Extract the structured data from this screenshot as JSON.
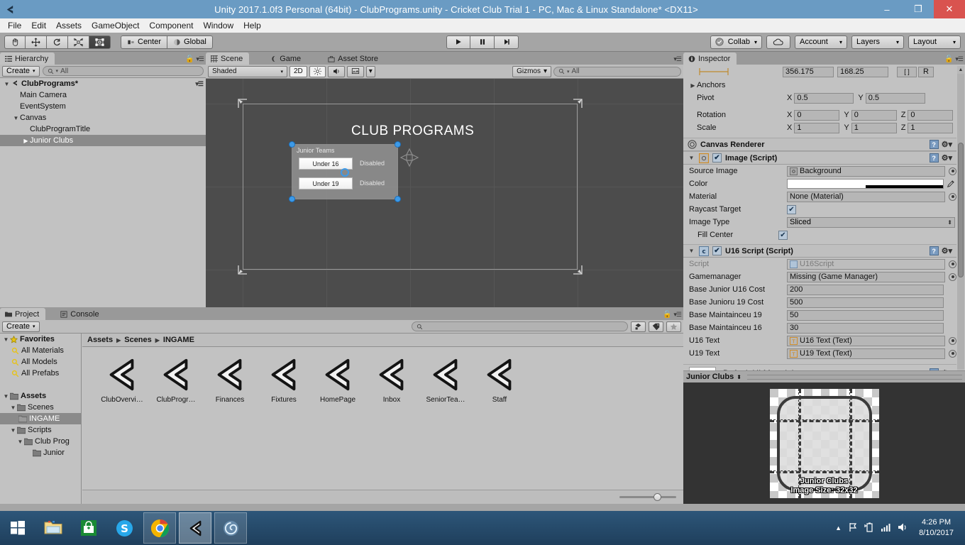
{
  "window": {
    "title": "Unity 2017.1.0f3 Personal (64bit) - ClubPrograms.unity - Cricket Club Trial 1 - PC, Mac & Linux Standalone* <DX11>",
    "minimize": "–",
    "maximize": "❐",
    "close": "✕",
    "app_icon": "unity-icon"
  },
  "menubar": {
    "items": [
      "File",
      "Edit",
      "Assets",
      "GameObject",
      "Component",
      "Window",
      "Help"
    ]
  },
  "toolbar": {
    "transform_tools": [
      {
        "name": "hand-tool",
        "glyph": "✋"
      },
      {
        "name": "move-tool",
        "glyph": "✥"
      },
      {
        "name": "rotate-tool",
        "glyph": "⟳"
      },
      {
        "name": "scale-tool",
        "glyph": "⤢"
      },
      {
        "name": "rect-tool",
        "glyph": "▣",
        "active": true
      }
    ],
    "pivot_label": "Center",
    "space_label": "Global",
    "play": "▶",
    "pause": "❚❚",
    "step": "▶|",
    "collab_label": "Collab",
    "cloud_label": "cloud-icon",
    "account_label": "Account",
    "layers_label": "Layers",
    "layout_label": "Layout",
    "caret": "▾"
  },
  "hierarchy": {
    "tab_label": "Hierarchy",
    "tab_icon": "hierarchy-icon",
    "create_label": "Create",
    "search_placeholder": "All",
    "scene_name": "ClubPrograms*",
    "items": [
      {
        "label": "Main Camera",
        "depth": 1,
        "arrow": "",
        "selected": false
      },
      {
        "label": "EventSystem",
        "depth": 1,
        "arrow": "",
        "selected": false
      },
      {
        "label": "Canvas",
        "depth": 1,
        "arrow": "▼",
        "selected": false
      },
      {
        "label": "ClubProgramTitle",
        "depth": 2,
        "arrow": "",
        "selected": false
      },
      {
        "label": "Junior Clubs",
        "depth": 2,
        "arrow": "▶",
        "selected": true
      }
    ]
  },
  "scene": {
    "tabs": [
      {
        "label": "Scene",
        "icon": "grid-icon",
        "active": true
      },
      {
        "label": "Game",
        "icon": "gamepad-icon",
        "active": false
      },
      {
        "label": "Asset Store",
        "icon": "store-icon",
        "active": false
      }
    ],
    "draw_mode": "Shaded",
    "mode_2d": "2D",
    "lighting_icon": "sun-icon",
    "audio_icon": "speaker-icon",
    "fx_icon": "image-icon",
    "gizmos_label": "Gizmos",
    "search_placeholder": "All",
    "canvas_title": "CLUB PROGRAMS",
    "junior_panel": {
      "title": "Junior Teams",
      "rows": [
        {
          "button": "Under 16",
          "status": "Disabled"
        },
        {
          "button": "Under 19",
          "status": "Disabled"
        }
      ]
    }
  },
  "project": {
    "tabs": [
      {
        "label": "Project",
        "icon": "folder-icon",
        "active": true
      },
      {
        "label": "Console",
        "icon": "console-icon",
        "active": false
      }
    ],
    "create_label": "Create",
    "search_placeholder": "",
    "tree": [
      {
        "label": "Favorites",
        "depth": 0,
        "arrow": "▼",
        "icon": "star-icon",
        "bold": true,
        "selected": false
      },
      {
        "label": "All Materials",
        "depth": 1,
        "arrow": "",
        "icon": "search-icon",
        "bold": false,
        "selected": false
      },
      {
        "label": "All Models",
        "depth": 1,
        "arrow": "",
        "icon": "search-icon",
        "bold": false,
        "selected": false
      },
      {
        "label": "All Prefabs",
        "depth": 1,
        "arrow": "",
        "icon": "search-icon",
        "bold": false,
        "selected": false
      },
      {
        "label": "",
        "depth": 0,
        "arrow": "",
        "icon": "",
        "bold": false,
        "selected": false
      },
      {
        "label": "Assets",
        "depth": 0,
        "arrow": "▼",
        "icon": "folder-icon",
        "bold": true,
        "selected": false
      },
      {
        "label": "Scenes",
        "depth": 1,
        "arrow": "▼",
        "icon": "folder-icon",
        "bold": false,
        "selected": false
      },
      {
        "label": "INGAME",
        "depth": 2,
        "arrow": "",
        "icon": "folder-icon",
        "bold": false,
        "selected": true
      },
      {
        "label": "Scripts",
        "depth": 1,
        "arrow": "▼",
        "icon": "folder-icon",
        "bold": false,
        "selected": false
      },
      {
        "label": "Club Prog",
        "depth": 2,
        "arrow": "▼",
        "icon": "folder-icon",
        "bold": false,
        "selected": false
      },
      {
        "label": "Junior",
        "depth": 3,
        "arrow": "",
        "icon": "folder-icon",
        "bold": false,
        "selected": false
      }
    ],
    "breadcrumb": [
      "Assets",
      "Scenes",
      "INGAME"
    ],
    "assets": [
      {
        "label": "ClubOvervi…",
        "icon": "unity-scene-icon"
      },
      {
        "label": "ClubProgr…",
        "icon": "unity-scene-icon"
      },
      {
        "label": "Finances",
        "icon": "unity-scene-icon"
      },
      {
        "label": "Fixtures",
        "icon": "unity-scene-icon"
      },
      {
        "label": "HomePage",
        "icon": "unity-scene-icon"
      },
      {
        "label": "Inbox",
        "icon": "unity-scene-icon"
      },
      {
        "label": "SeniorTea…",
        "icon": "unity-scene-icon"
      },
      {
        "label": "Staff",
        "icon": "unity-scene-icon"
      }
    ],
    "toolbar_icons": [
      "assets-filter-icon",
      "label-filter-icon",
      "favorite-filter-icon"
    ]
  },
  "inspector": {
    "tab_label": "Inspector",
    "tab_icon": "info-icon",
    "rect_top": {
      "width": "356.175",
      "height": "168.25",
      "blueprint": "[ ]",
      "raw": "R"
    },
    "anchors_label": "Anchors",
    "pivot": {
      "label": "Pivot",
      "x_axis": "X",
      "x": "0.5",
      "y_axis": "Y",
      "y": "0.5"
    },
    "rotation": {
      "label": "Rotation",
      "x_axis": "X",
      "x": "0",
      "y_axis": "Y",
      "y": "0",
      "z_axis": "Z",
      "z": "0"
    },
    "scale": {
      "label": "Scale",
      "x_axis": "X",
      "x": "1",
      "y_axis": "Y",
      "y": "1",
      "z_axis": "Z",
      "z": "1"
    },
    "canvas_renderer": {
      "title": "Canvas Renderer",
      "icon": "canvas-renderer-icon"
    },
    "image_script": {
      "title": "Image (Script)",
      "icon": "image-component-icon",
      "enabled": true,
      "fields": [
        {
          "label": "Source Image",
          "value": "Background",
          "type": "object"
        },
        {
          "label": "Color",
          "value": "",
          "type": "color"
        },
        {
          "label": "Material",
          "value": "None (Material)",
          "type": "object"
        },
        {
          "label": "Raycast Target",
          "value": "",
          "type": "checkbox",
          "checked": true
        },
        {
          "label": "Image Type",
          "value": "Sliced",
          "type": "dropdown"
        },
        {
          "label": "Fill Center",
          "value": "",
          "type": "checkbox",
          "checked": true,
          "indent": true
        }
      ]
    },
    "u16_script": {
      "title": "U16 Script (Script)",
      "icon": "csharp-icon",
      "enabled": true,
      "fields": [
        {
          "label": "Script",
          "value": "U16Script",
          "type": "object-dim"
        },
        {
          "label": "Gamemanager",
          "value": "Missing (Game Manager)",
          "type": "object"
        },
        {
          "label": "Base Junior U16 Cost",
          "value": "200",
          "type": "text"
        },
        {
          "label": "Base Junioru 19 Cost",
          "value": "500",
          "type": "text"
        },
        {
          "label": "Base Maintainceu 19",
          "value": "50",
          "type": "text"
        },
        {
          "label": "Base Maintainceu 16",
          "value": "30",
          "type": "text"
        },
        {
          "label": "U16 Text",
          "value": "U16 Text (Text)",
          "type": "object-text"
        },
        {
          "label": "U19 Text",
          "value": "U19 Text (Text)",
          "type": "object-text"
        }
      ]
    },
    "material_row": {
      "label": "Default UI Material"
    },
    "preview": {
      "title": "Junior Clubs",
      "caption_name": "Junior Clubs",
      "caption_size": "Image Size: 32x32"
    }
  },
  "taskbar": {
    "items": [
      {
        "name": "start-button",
        "icon": "windows-logo"
      },
      {
        "name": "file-explorer",
        "icon": "folder"
      },
      {
        "name": "microsoft-store",
        "icon": "store"
      },
      {
        "name": "skype",
        "icon": "skype"
      },
      {
        "name": "google-chrome",
        "icon": "chrome",
        "open": true
      },
      {
        "name": "unity-editor",
        "icon": "unity",
        "active": true
      },
      {
        "name": "media-app",
        "icon": "swirl",
        "open": true
      }
    ],
    "tray": [
      "show-hidden-icons",
      "flag-icon",
      "battery-icon",
      "network-icon",
      "volume-icon"
    ],
    "time": "4:26 PM",
    "date": "8/10/2017"
  }
}
